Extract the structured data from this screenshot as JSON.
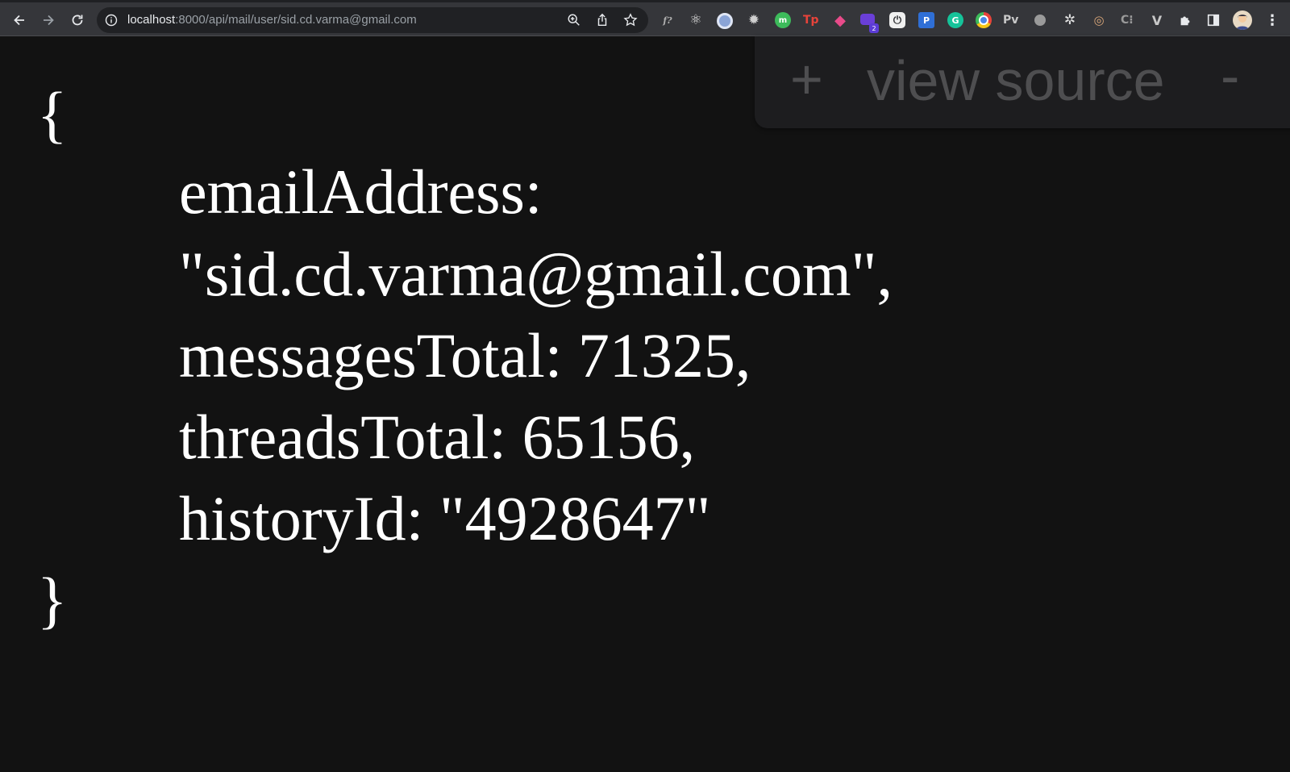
{
  "browser": {
    "url_host": "localhost",
    "url_path": ":8000/api/mail/user/sid.cd.varma@gmail.com",
    "extensions": [
      {
        "name": "formula-icon",
        "text": "f?",
        "color": "#35363a"
      },
      {
        "name": "react-devtools-icon",
        "text": "⚛",
        "color": "#35363a"
      },
      {
        "name": "circle-ext-icon",
        "text": "",
        "color": "#8aa4d6"
      },
      {
        "name": "gear-ext-icon",
        "text": "✹",
        "color": "#35363a"
      },
      {
        "name": "green-ext-icon",
        "text": "",
        "color": "#3dbb5b"
      },
      {
        "name": "tp-ext-icon",
        "text": "Tp",
        "color": "#35363a"
      },
      {
        "name": "colorful-ext-icon",
        "text": "◆",
        "color": "#35363a"
      },
      {
        "name": "purple-ext-icon",
        "text": "",
        "color": "#6a3fd8"
      },
      {
        "name": "power-ext-icon",
        "text": "⏻",
        "color": "#35363a"
      },
      {
        "name": "p-ext-icon",
        "text": "P",
        "color": "#2f6fd6"
      },
      {
        "name": "grammarly-icon",
        "text": "G",
        "color": "#15c39a"
      },
      {
        "name": "chrome-ext-icon",
        "text": "",
        "color": "#e8a33a"
      },
      {
        "name": "pv-ext-icon",
        "text": "Pv",
        "color": "#35363a"
      },
      {
        "name": "grey-dot-ext-icon",
        "text": "",
        "color": "#9a9a9a"
      },
      {
        "name": "wheel-ext-icon",
        "text": "✲",
        "color": "#35363a"
      },
      {
        "name": "owl-ext-icon",
        "text": "◎",
        "color": "#35363a"
      },
      {
        "name": "c-ext-icon",
        "text": "C⁝",
        "color": "#35363a"
      },
      {
        "name": "v-ext-icon",
        "text": "V",
        "color": "#35363a"
      }
    ],
    "purple_badge": "2"
  },
  "json_view": {
    "open_brace": "{",
    "close_brace": "}",
    "line_email_key": "emailAddress:",
    "line_email_value": "\"sid.cd.varma@gmail.com\",",
    "line_messages": "messagesTotal: 71325,",
    "line_threads": "threadsTotal: 65156,",
    "line_history": "historyId: \"4928647\""
  },
  "view_source": {
    "plus": "+",
    "label": "view source",
    "minus": "-"
  }
}
